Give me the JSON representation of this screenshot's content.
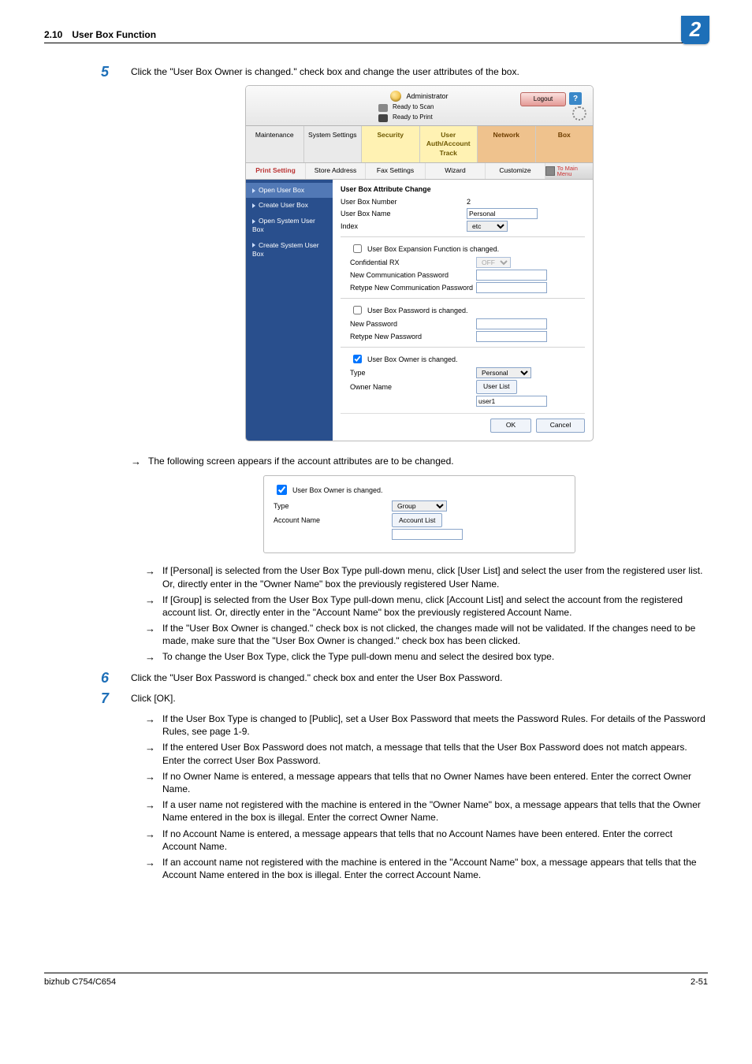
{
  "header": {
    "sec": "2.10",
    "title": "User Box Function",
    "chapter": "2"
  },
  "footer": {
    "model": "bizhub C754/C654",
    "page": "2-51"
  },
  "step5": {
    "num": "5",
    "text": "Click the \"User Box Owner is changed.\" check box and change the user attributes of the box."
  },
  "intermission": {
    "text": "The following screen appears if the account attributes are to be changed."
  },
  "notes5": [
    "If [Personal] is selected from the User Box Type pull-down menu, click [User List] and select the user from the registered user list. Or, directly enter in the \"Owner Name\" box the previously registered User Name.",
    "If [Group] is selected from the User Box Type pull-down menu, click [Account List] and select the account from the registered account list. Or, directly enter in the \"Account Name\" box the previously registered Account Name.",
    "If the \"User Box Owner is changed.\" check box is not clicked, the changes made will not be validated. If the changes need to be made, make sure that the \"User Box Owner is changed.\" check box has been clicked.",
    "To change the User Box Type, click the Type pull-down menu and select the desired box type."
  ],
  "step6": {
    "num": "6",
    "text": "Click the \"User Box Password is changed.\" check box and enter the User Box Password."
  },
  "step7": {
    "num": "7",
    "text": "Click [OK]."
  },
  "notes7": [
    "If the User Box Type is changed to [Public], set a User Box Password that meets the Password Rules. For details of the Password Rules, see page 1-9.",
    "If the entered User Box Password does not match, a message that tells that the User Box Password does not match appears. Enter the correct User Box Password.",
    "If no Owner Name is entered, a message appears that tells that no Owner Names have been entered. Enter the correct Owner Name.",
    "If a user name not registered with the machine is entered in the \"Owner Name\" box, a message appears that tells that the Owner Name entered in the box is illegal. Enter the correct Owner Name.",
    "If no Account Name is entered, a message appears that tells that no Account Names have been entered. Enter the correct Account Name.",
    "If an account name not registered with the machine is entered in the \"Account Name\" box, a message appears that tells that the Account Name entered in the box is illegal. Enter the correct Account Name."
  ],
  "ui": {
    "admin_label": "Administrator",
    "logout": "Logout",
    "help": "?",
    "ready_scan": "Ready to Scan",
    "ready_print": "Ready to Print",
    "tabs": {
      "maintenance": "Maintenance",
      "system": "System Settings",
      "security": "Security",
      "auth": "User Auth/Account Track",
      "network": "Network",
      "box": "Box"
    },
    "subtabs": {
      "print": "Print Setting",
      "store": "Store Address",
      "fax": "Fax Settings",
      "wizard": "Wizard",
      "customize": "Customize",
      "mainmenu": "To Main Menu"
    },
    "sidebar": {
      "open_user_box": "Open User Box",
      "create_user_box": "Create User Box",
      "open_system_user_box": "Open System User Box",
      "create_system_user_box": "Create System User Box"
    },
    "panel": {
      "title": "User Box Attribute Change",
      "user_box_number_label": "User Box Number",
      "user_box_number_value": "2",
      "user_box_name_label": "User Box Name",
      "user_box_name_value": "Personal",
      "index_label": "Index",
      "index_value": "etc",
      "expansion_check": "User Box Expansion Function is changed.",
      "confidential_rx": "Confidential RX",
      "confidential_rx_value": "OFF",
      "new_comm_pwd": "New Communication Password",
      "retype_comm_pwd": "Retype New Communication Password",
      "pwd_check": "User Box Password is changed.",
      "new_pwd": "New Password",
      "retype_pwd": "Retype New Password",
      "owner_check": "User Box Owner is changed.",
      "type_label": "Type",
      "type_value": "Personal",
      "owner_name_label": "Owner Name",
      "user_list_btn": "User List",
      "owner_name_value": "user1",
      "ok": "OK",
      "cancel": "Cancel"
    },
    "inset": {
      "owner_check": "User Box Owner is changed.",
      "type_label": "Type",
      "type_value": "Group",
      "account_name_label": "Account Name",
      "account_list_btn": "Account List"
    }
  }
}
